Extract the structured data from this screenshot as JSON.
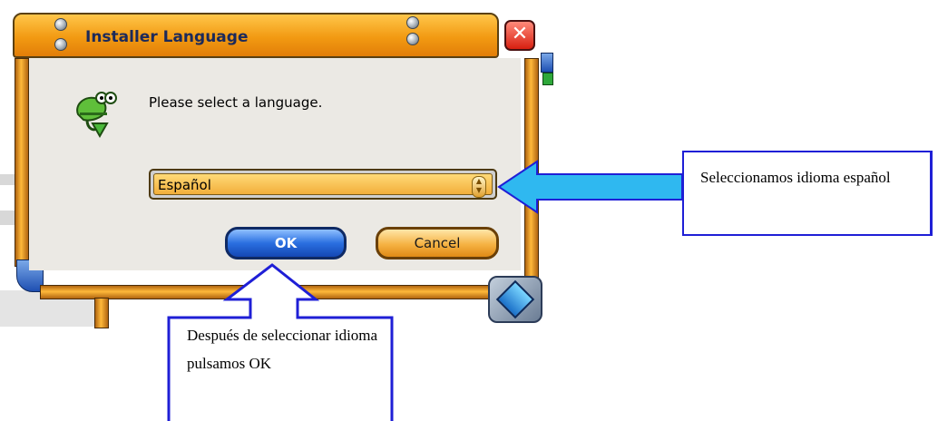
{
  "window": {
    "title": "Installer Language",
    "close_glyph": "✕"
  },
  "dialog": {
    "prompt": "Please select a language.",
    "language_select": {
      "value": "Español"
    },
    "ok_label": "OK",
    "cancel_label": "Cancel"
  },
  "icons": {
    "app": "chameleon-installer-icon",
    "close": "close-icon",
    "spin": "spin-arrows-icon",
    "corner": "corner-emblem-icon"
  },
  "annotations": {
    "right_note": "Seleccionamos idioma español",
    "bottom_note": "Después de seleccionar idioma pulsamos OK"
  },
  "colors": {
    "frame_orange": "#f29a12",
    "frame_blue": "#1e4fb2",
    "callout_border": "#1f1fd6",
    "callout_arrow_fill": "#2fb8f0"
  }
}
